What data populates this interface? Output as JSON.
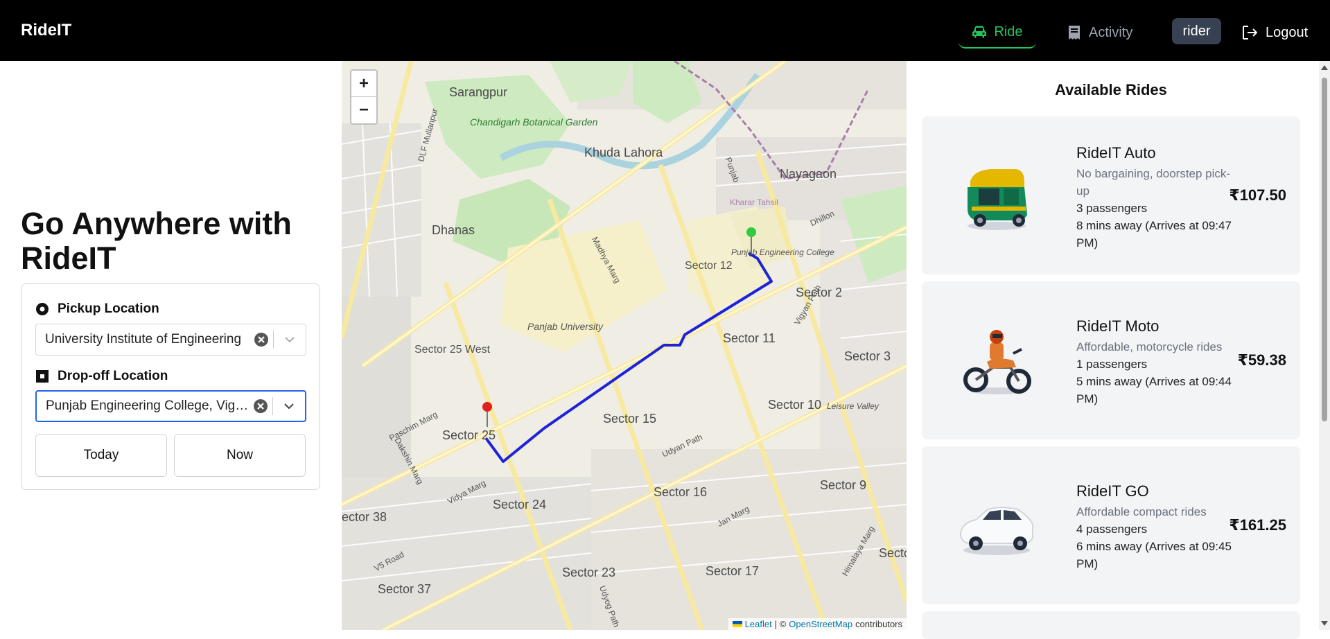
{
  "app": {
    "brand": "RideIT"
  },
  "nav": {
    "ride_label": "Ride",
    "activity_label": "Activity",
    "user_label": "rider",
    "logout_label": "Logout"
  },
  "hero": {
    "title": "Go Anywhere with RideIT"
  },
  "form": {
    "pickup_label": "Pickup Location",
    "pickup_value": "University Institute of Engineering",
    "dropoff_label": "Drop-off Location",
    "dropoff_value": "Punjab Engineering College, Vigy...",
    "date_button": "Today",
    "time_button": "Now"
  },
  "map": {
    "zoom_in": "+",
    "zoom_out": "−",
    "attribution_leaflet": "Leaflet",
    "attribution_sep": "| ©",
    "attribution_osm": "OpenStreetMap",
    "attribution_tail": "contributors",
    "labels": {
      "sarangpur": "Sarangpur",
      "botanical": "Chandigarh Botanical Garden",
      "khuda": "Khuda Lahora",
      "nayagaon": "Nayagaon",
      "dhanas": "Dhanas",
      "sector12": "Sector 12",
      "pec": "Punjab Engineering College",
      "sector2": "Sector 2",
      "pu": "Panjab University",
      "sector25w": "Sector 25 West",
      "sector11": "Sector 11",
      "sector3": "Sector 3",
      "sector10": "Sector 10",
      "leisure": "Leisure Valley",
      "sector15": "Sector 15",
      "sector25": "Sector 25",
      "sector16": "Sector 16",
      "sector9": "Sector 9",
      "sector24": "Sector 24",
      "sector38": "ector 38",
      "sector23": "Sector 23",
      "sector17": "Sector 17",
      "sector37": "Sector 37",
      "kharar": "Kharar Tahsil",
      "vidya": "Vidya Marg",
      "madhya": "Madhya Marg",
      "udyan": "Udyan Path",
      "dakshin": "Dakshin Marg",
      "paschim": "Paschim Marg",
      "jan": "Jan Marg",
      "himalaya": "Himalaya Marg",
      "dlf": "DLF Mullanpur",
      "vigyan": "Vigyan Path",
      "udyog": "Udyog Path",
      "v5": "V5 Road",
      "dhillon": "Dhillon",
      "punjab": "Punjab",
      "secto": "Secto"
    },
    "colors": {
      "route": "#1d23d6",
      "pickup_pin": "#2ecc40",
      "dropoff_pin": "#e02020"
    }
  },
  "rides": {
    "title": "Available Rides",
    "items": [
      {
        "name": "RideIT Auto",
        "desc": "No bargaining, doorstep pick-up",
        "passengers": "3 passengers",
        "eta": "8 mins away (Arrives at 09:47 PM)",
        "price": "₹107.50",
        "icon": "auto-rickshaw-icon"
      },
      {
        "name": "RideIT Moto",
        "desc": "Affordable, motorcycle rides",
        "passengers": "1 passengers",
        "eta": "5 mins away (Arrives at 09:44 PM)",
        "price": "₹59.38",
        "icon": "motorcycle-icon"
      },
      {
        "name": "RideIT GO",
        "desc": "Affordable compact rides",
        "passengers": "4 passengers",
        "eta": "6 mins away (Arrives at 09:45 PM)",
        "price": "₹161.25",
        "icon": "car-icon"
      }
    ]
  },
  "colors": {
    "accent_green": "#22c55e",
    "nav_bg": "#000000",
    "card_bg": "#f3f4f6",
    "focus_blue": "#2563eb"
  }
}
